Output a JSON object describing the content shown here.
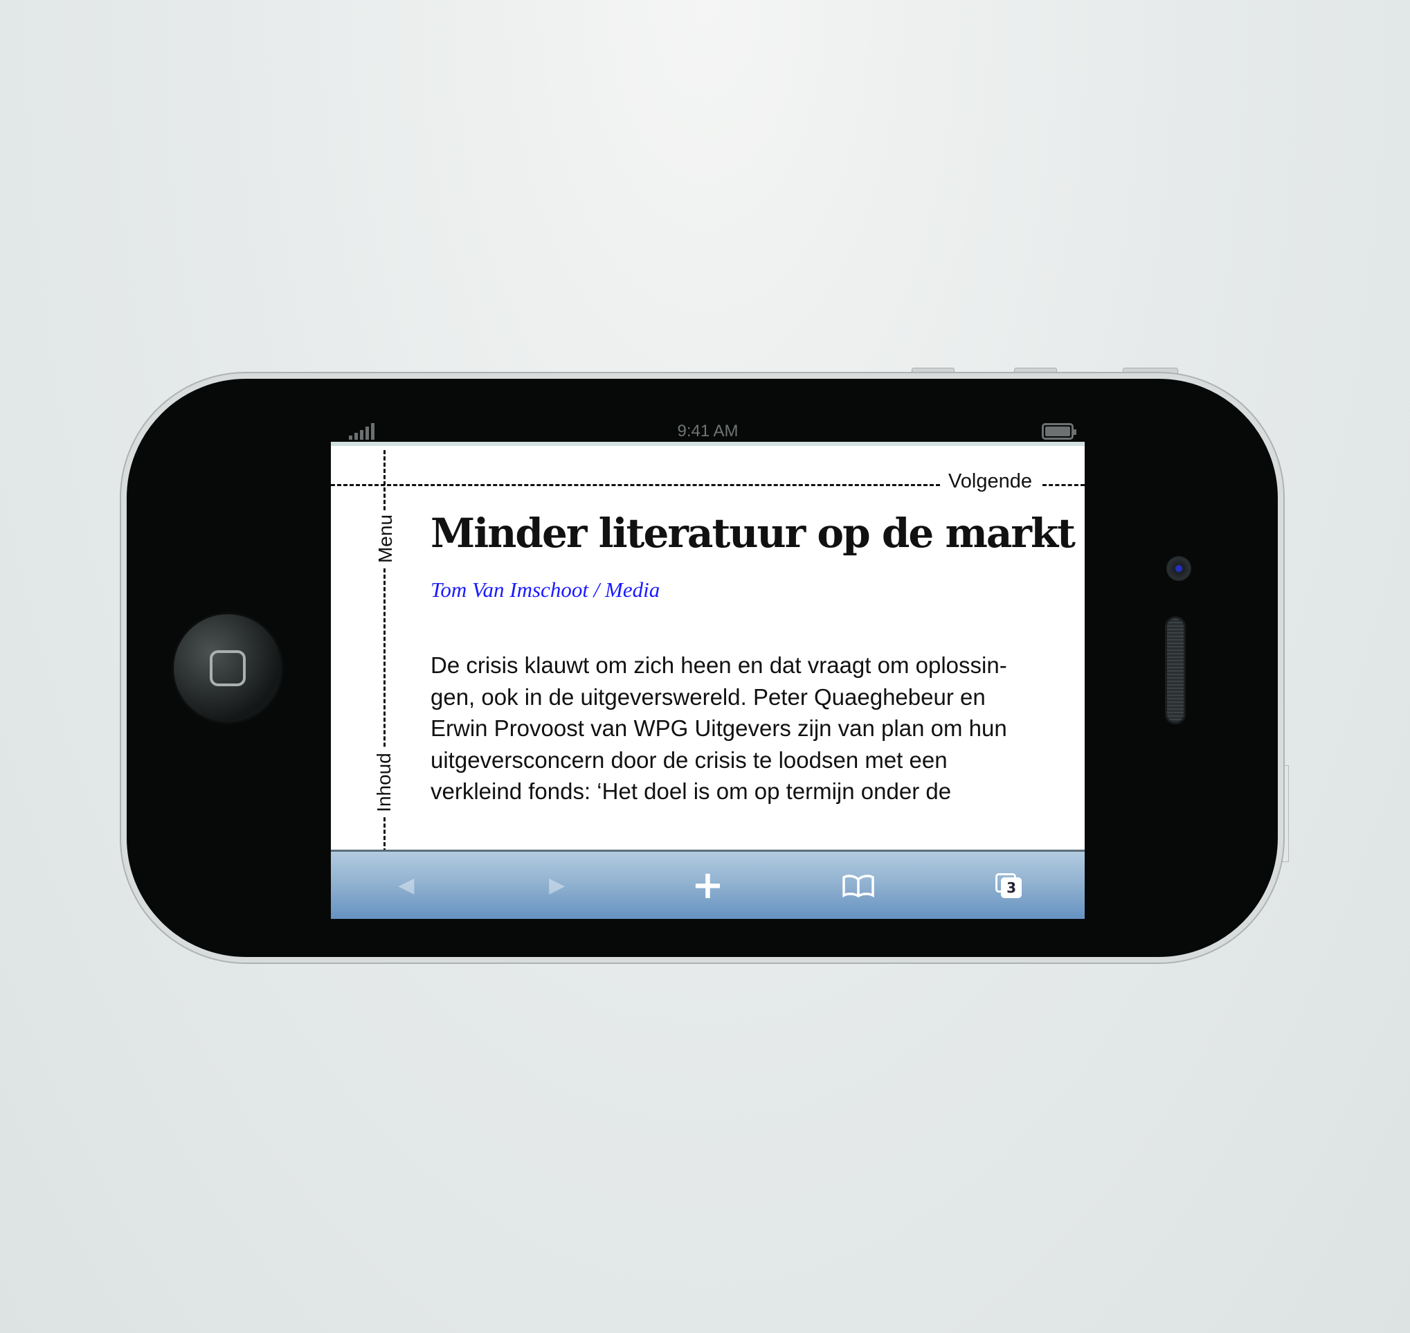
{
  "status_bar": {
    "time": "9:41 AM"
  },
  "article": {
    "next_label": "Volgende",
    "menu_label": "Menu",
    "contents_label": "Inhoud",
    "title": "Minder literatuur op de markt",
    "byline": "Tom Van Imschoot / Media",
    "body_lines": [
      "De crisis klauwt om zich heen en dat vraagt om oplossin-",
      "gen, ook in de uitgeverswereld. Peter Quaeghebeur en",
      "Erwin Provoost van WPG Uitgevers zijn van plan om hun",
      "uitgeversconcern door de crisis te loodsen met een",
      "verkleind fonds: ‘Het doel is om op termijn onder de"
    ]
  },
  "toolbar": {
    "back": "◀",
    "forward": "▶",
    "add": "+",
    "bookmarks": "bookmarks",
    "tabs_count": "3"
  },
  "colors": {
    "byline": "#1a1aff",
    "toolbar": "#8fb0cf"
  }
}
